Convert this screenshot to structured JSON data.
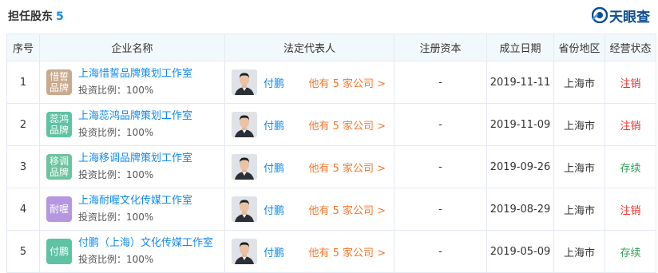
{
  "section": {
    "title": "担任股东",
    "count": "5"
  },
  "brand": {
    "logo_text": "天眼查",
    "color": "#0d4e92"
  },
  "table": {
    "headers": [
      "序号",
      "企业名称",
      "法定代表人",
      "注册资本",
      "成立日期",
      "省份地区",
      "经营状态"
    ],
    "rows": [
      {
        "index": "1",
        "logo_text": "惜誓\n品牌",
        "logo_color": "#c9a98d",
        "company": "上海惜誓品牌策划工作室",
        "invest": "投资比例：100%",
        "legal_name": "付鹏",
        "more": "他有 5 家公司 >",
        "capital": "-",
        "date": "2019-11-11",
        "region": "上海市",
        "status": "注销",
        "status_type": "cancel"
      },
      {
        "index": "2",
        "logo_text": "蕊鸿\n品牌",
        "logo_color": "#5fc2a2",
        "company": "上海蕊鸿品牌策划工作室",
        "invest": "投资比例：100%",
        "legal_name": "付鹏",
        "more": "他有 5 家公司 >",
        "capital": "-",
        "date": "2019-11-09",
        "region": "上海市",
        "status": "注销",
        "status_type": "cancel"
      },
      {
        "index": "3",
        "logo_text": "移调\n品牌",
        "logo_color": "#6cc39f",
        "company": "上海移调品牌策划工作室",
        "invest": "投资比例：100%",
        "legal_name": "付鹏",
        "more": "他有 5 家公司 >",
        "capital": "-",
        "date": "2019-09-26",
        "region": "上海市",
        "status": "存续",
        "status_type": "active"
      },
      {
        "index": "4",
        "logo_text": "耐喔",
        "logo_color": "#b497e0",
        "company": "上海耐喔文化传媒工作室",
        "invest": "投资比例：100%",
        "legal_name": "付鹏",
        "more": "他有 5 家公司 >",
        "capital": "-",
        "date": "2019-08-29",
        "region": "上海市",
        "status": "注销",
        "status_type": "cancel"
      },
      {
        "index": "5",
        "logo_text": "付鹏",
        "logo_color": "#5fc2a2",
        "company": "付鹏（上海）文化传媒工作室",
        "invest": "投资比例：100%",
        "legal_name": "付鹏",
        "more": "他有 5 家公司 >",
        "capital": "-",
        "date": "2019-05-09",
        "region": "上海市",
        "status": "存续",
        "status_type": "active"
      }
    ]
  }
}
